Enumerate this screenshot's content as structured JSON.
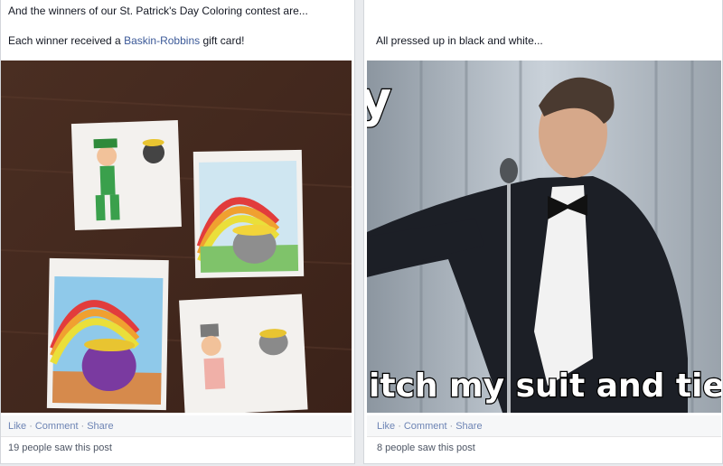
{
  "posts": [
    {
      "line1": "And the winners of our St. Patrick's Day Coloring contest are...",
      "line2_prefix": "Each winner received a ",
      "line2_link": "Baskin-Robbins",
      "line2_suffix": " gift card!",
      "actions": {
        "like": "Like",
        "comment": "Comment",
        "share": "Share",
        "separator": "·"
      },
      "seen": "19 people saw this post"
    },
    {
      "line1": "All pressed up in black and white...",
      "meme_top": "y",
      "meme_bottom": "itch my suit and tie",
      "actions": {
        "like": "Like",
        "comment": "Comment",
        "share": "Share",
        "separator": "·"
      },
      "seen": "8 people saw this post"
    }
  ],
  "colors": {
    "link": "#3b5998",
    "action_bar": "#f6f7f8",
    "page_bg": "#e9ebee"
  }
}
